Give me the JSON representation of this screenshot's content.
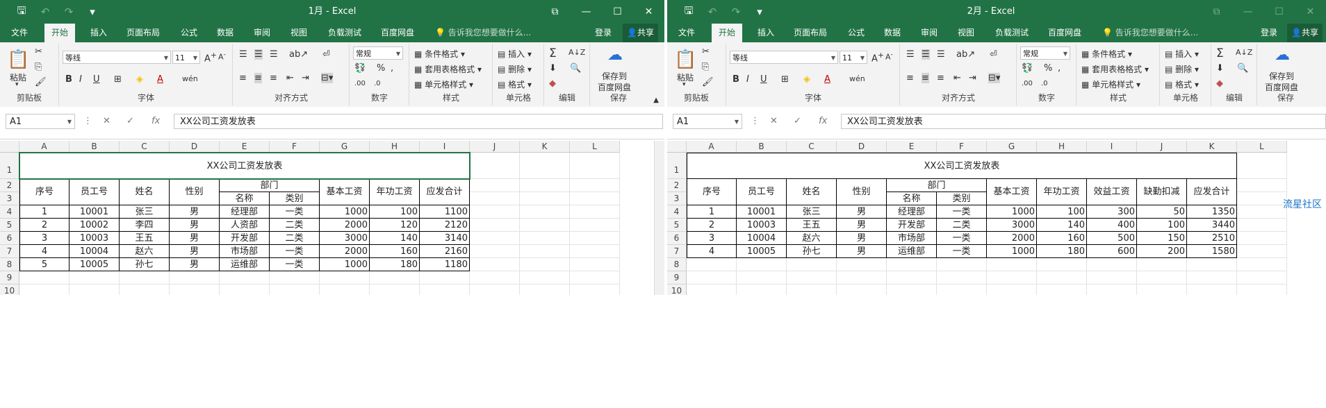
{
  "windows": [
    {
      "title": "1月 - Excel",
      "menu": {
        "file": "文件",
        "home": "开始",
        "insert": "插入",
        "layout": "页面布局",
        "formulas": "公式",
        "data": "数据",
        "review": "审阅",
        "view": "视图",
        "loadtest": "负载测试",
        "baidu": "百度网盘",
        "tell": "告诉我您想要做什么...",
        "login": "登录",
        "share": "共享"
      },
      "ribbon": {
        "paste": "粘贴",
        "clipboard": "剪贴板",
        "font_name": "等线",
        "font_size": "11",
        "font": "字体",
        "align": "对齐方式",
        "number_format": "常规",
        "number": "数字",
        "cond_format": "条件格式",
        "table_format": "套用表格格式",
        "cell_style": "单元格样式",
        "styles": "样式",
        "insert": "插入",
        "delete": "删除",
        "format": "格式",
        "cells": "单元格",
        "editing": "编辑",
        "save_baidu": "保存到\n百度网盘",
        "save_baidu_1": "保存到",
        "save_baidu_2": "百度网盘",
        "save": "保存"
      },
      "namebox": "A1",
      "formula": "XX公司工资发放表",
      "columns": [
        "A",
        "B",
        "C",
        "D",
        "E",
        "F",
        "G",
        "H",
        "I",
        "J",
        "K",
        "L"
      ],
      "rows": [
        "1",
        "2",
        "3",
        "4",
        "5",
        "6",
        "7",
        "8",
        "9",
        "10"
      ],
      "table": {
        "title": "XX公司工资发放表",
        "headers": {
          "seq": "序号",
          "emp_id": "员工号",
          "name": "姓名",
          "gender": "性别",
          "dept": "部门",
          "dept_name": "名称",
          "dept_type": "类别",
          "base": "基本工资",
          "seniority": "年功工资",
          "total": "应发合计"
        },
        "rows": [
          [
            "1",
            "10001",
            "张三",
            "男",
            "经理部",
            "一类",
            "1000",
            "100",
            "1100"
          ],
          [
            "2",
            "10002",
            "李四",
            "男",
            "人资部",
            "二类",
            "2000",
            "120",
            "2120"
          ],
          [
            "3",
            "10003",
            "王五",
            "男",
            "开发部",
            "二类",
            "3000",
            "140",
            "3140"
          ],
          [
            "4",
            "10004",
            "赵六",
            "男",
            "市场部",
            "一类",
            "2000",
            "160",
            "2160"
          ],
          [
            "5",
            "10005",
            "孙七",
            "男",
            "运维部",
            "一类",
            "1000",
            "180",
            "1180"
          ]
        ]
      }
    },
    {
      "title": "2月 - Excel",
      "menu": {
        "file": "文件",
        "home": "开始",
        "insert": "插入",
        "layout": "页面布局",
        "formulas": "公式",
        "data": "数据",
        "review": "审阅",
        "view": "视图",
        "loadtest": "负载测试",
        "baidu": "百度网盘",
        "tell": "告诉我您想要做什么...",
        "login": "登录",
        "share": "共享"
      },
      "ribbon": {
        "paste": "粘贴",
        "clipboard": "剪贴板",
        "font_name": "等线",
        "font_size": "11",
        "font": "字体",
        "align": "对齐方式",
        "number_format": "常规",
        "number": "数字",
        "cond_format": "条件格式",
        "table_format": "套用表格格式",
        "cell_style": "单元格样式",
        "styles": "样式",
        "insert": "插入",
        "delete": "删除",
        "format": "格式",
        "cells": "单元格",
        "editing": "编辑",
        "save_baidu_1": "保存到",
        "save_baidu_2": "百度网盘",
        "save": "保存"
      },
      "namebox": "A1",
      "formula": "XX公司工资发放表",
      "columns": [
        "A",
        "B",
        "C",
        "D",
        "E",
        "F",
        "G",
        "H",
        "I",
        "J",
        "K",
        "L"
      ],
      "rows": [
        "1",
        "2",
        "3",
        "4",
        "5",
        "6",
        "7",
        "8",
        "9",
        "10"
      ],
      "table": {
        "title": "XX公司工资发放表",
        "headers": {
          "seq": "序号",
          "emp_id": "员工号",
          "name": "姓名",
          "gender": "性别",
          "dept": "部门",
          "dept_name": "名称",
          "dept_type": "类别",
          "base": "基本工资",
          "seniority": "年功工资",
          "bonus": "效益工资",
          "absence": "缺勤扣减",
          "total": "应发合计"
        },
        "rows": [
          [
            "1",
            "10001",
            "张三",
            "男",
            "经理部",
            "一类",
            "1000",
            "100",
            "300",
            "50",
            "1350"
          ],
          [
            "2",
            "10003",
            "王五",
            "男",
            "开发部",
            "二类",
            "3000",
            "140",
            "400",
            "100",
            "3440"
          ],
          [
            "3",
            "10004",
            "赵六",
            "男",
            "市场部",
            "一类",
            "2000",
            "160",
            "500",
            "150",
            "2510"
          ],
          [
            "4",
            "10005",
            "孙七",
            "男",
            "运维部",
            "一类",
            "1000",
            "180",
            "600",
            "200",
            "1580"
          ]
        ]
      },
      "watermark": "流星社区"
    }
  ],
  "colors": {
    "accent": "#217346"
  }
}
